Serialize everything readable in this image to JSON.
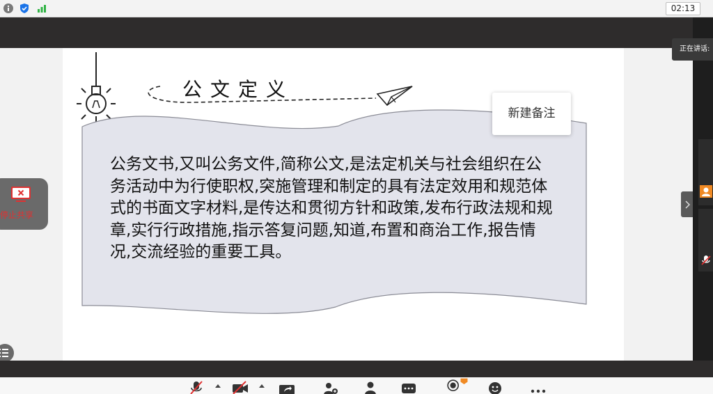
{
  "status_bar": {
    "icons": [
      "info-icon",
      "shield-icon",
      "signal-bars-icon"
    ],
    "clock": "02:13"
  },
  "slide": {
    "title": "公文定义",
    "body": "公务文书,又叫公务文件,简称公文,是法定机关与社会组织在公务活动中为行使职权,突施管理和制定的具有法定效用和规范体式的书面文字材料,是传达和贯彻方针和政策,发布行政法规和规章,实行行政措施,指示答复问题,知道,布置和商治工作,报告情况,交流经验的重要工具。"
  },
  "note_button": {
    "label": "新建备注"
  },
  "stop_share": {
    "label": "停止共享"
  },
  "speaking": {
    "label": "正在讲话:"
  },
  "toolbar": {
    "icons": [
      "mic-muted-icon",
      "camera-off-icon",
      "share-screen-icon",
      "invite-icon",
      "participants-icon",
      "chat-icon",
      "record-icon",
      "reactions-icon",
      "more-icon"
    ]
  },
  "colors": {
    "accent_red": "#e03131",
    "scroll_fill": "#e3e4ec",
    "dark_band": "#2e2c2c",
    "participant_orange": "#f08a24"
  }
}
